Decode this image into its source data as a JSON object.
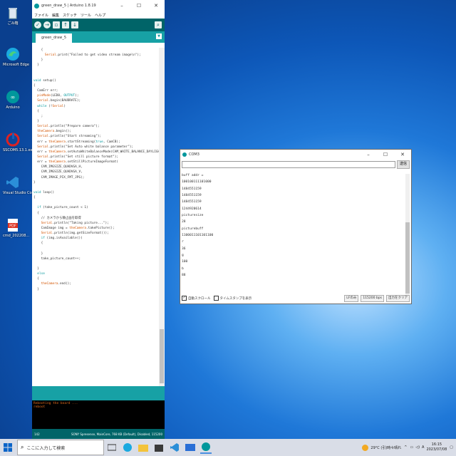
{
  "desktop_icons": [
    {
      "label": "ごみ箱",
      "icon": "recycle-bin-icon"
    },
    {
      "label": "Microsoft Edge",
      "icon": "edge-icon"
    },
    {
      "label": "Arduino",
      "icon": "arduino-icon"
    },
    {
      "label": "SSCOM5.13.1.exe",
      "icon": "sscom-icon"
    },
    {
      "label": "Visual Studio Code",
      "icon": "vscode-icon"
    },
    {
      "label": "cmd_202208...",
      "icon": "pdf-icon"
    }
  ],
  "ide": {
    "title": "green_draw_5 | Arduino 1.8.19",
    "menu": [
      "ファイル",
      "編集",
      "スケッチ",
      "ツール",
      "ヘルプ"
    ],
    "tab": "green_draw_5",
    "code_lines": [
      "    {",
      "      Serial.print(\"Failed to get video stream image\\n\");",
      "    }",
      "  }",
      "",
      "",
      "void setup()",
      "{",
      "  CamErr err;",
      "  pinMode(LED0, OUTPUT);",
      "  Serial.begin(BAUDRATE);",
      "  while (!Serial)",
      "  {",
      "    ;",
      "  }",
      "  Serial.println(\"Prepare camera\");",
      "  theCamera.begin();",
      "  Serial.println(\"Start streaming\");",
      "  err = theCamera.startStreaming(true, CamCB);",
      "  Serial.println(\"Set Auto white balance parameter\");",
      "  err = theCamera.setAutoWhiteBalanceMode(CAM_WHITE_BALANCE_DAYLIGHT);",
      "  Serial.println(\"Set still picture format\");",
      "  err = theCamera.setStillPictureImageFormat(",
      "    CAM_IMGSIZE_QUADVGA_H,",
      "    CAM_IMGSIZE_QUADVGA_V,",
      "    CAM_IMAGE_PIX_FMT_JPG);",
      "}",
      "",
      "void loop()",
      "{",
      "",
      "  if (take_picture_count < 1)",
      "  {",
      "    // カメラから静止画を取得",
      "    Serial.println(\"Taking picture...\");",
      "    CamImage img = theCamera.takePicture();",
      "    Serial.println(img.getSizeFormat());",
      "    if (img.isAvailable())",
      "    {",
      "",
      "    }",
      "    take_picture_count++;",
      "",
      "  }",
      "  else",
      "  {",
      "    theCamera.end();",
      "  }"
    ],
    "console_lines": [
      "Rebooting the board ...",
      "reboot"
    ],
    "status_line": "142",
    "status_right": "SONY Spresense, MainCore, 768 KB (Default), Disabled, 115200"
  },
  "serial": {
    "title": "COM3",
    "send_label": "送信",
    "output_lines": [
      "buff addr =",
      "100100111101000",
      "1484551159",
      "1484551159",
      "1484551159",
      "1244920614",
      "picturesize",
      "28",
      "picturebuff",
      "1100011101101100",
      "r",
      "36",
      "g",
      "100",
      "b",
      "88"
    ],
    "autoscroll_label": "自動スクロール",
    "timestamp_label": "タイムスタンプを表示",
    "line_ending": "LFのみ",
    "baud": "115200 bps",
    "clear_label": "出力をクリア"
  },
  "taskbar": {
    "search_placeholder": "ここに入力して検索",
    "weather": "29°C  (引)時々晴れ",
    "time": "16:15",
    "date": "2023/07/08"
  }
}
